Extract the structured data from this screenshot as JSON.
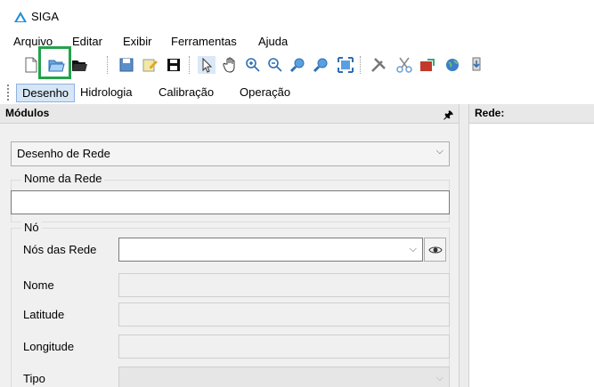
{
  "window": {
    "title": "SIGA"
  },
  "menu": [
    "Arquivo",
    "Editar",
    "Exibir",
    "Ferramentas",
    "Ajuda"
  ],
  "toolbar": {
    "highlighted_tool": "open-folder-icon"
  },
  "tabs": [
    {
      "label": "Desenho",
      "active": true
    },
    {
      "label": "Hidrologia",
      "active": false
    },
    {
      "label": "Calibração",
      "active": false
    },
    {
      "label": "Operação",
      "active": false
    }
  ],
  "left_panel": {
    "title": "Módulos",
    "pin": "🡄",
    "module_select": {
      "value": "Desenho de Rede"
    },
    "network_name_group": {
      "label": "Nome da Rede",
      "value": ""
    },
    "node_group": {
      "label": "Nó",
      "fields": [
        {
          "label": "Nós das Rede",
          "value": ""
        },
        {
          "label": "Nome",
          "value": ""
        },
        {
          "label": "Latitude",
          "value": ""
        },
        {
          "label": "Longitude",
          "value": ""
        },
        {
          "label": "Tipo",
          "value": ""
        }
      ]
    }
  },
  "right_panel": {
    "title": "Rede:"
  },
  "colors": {
    "highlight": "#23a34a",
    "active_tab": "#d6e6f5",
    "logo": "#1e8fd6"
  }
}
